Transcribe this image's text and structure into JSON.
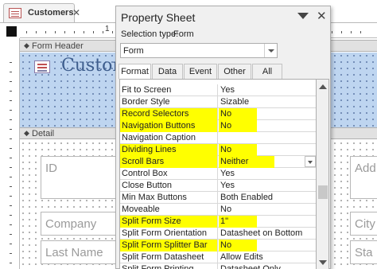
{
  "document_tab": {
    "label": "Customers"
  },
  "ruler": {
    "mark_1": "1"
  },
  "sections": {
    "form_header": "Form Header",
    "detail": "Detail"
  },
  "header": {
    "title_fragment": "Custon"
  },
  "detail": {
    "fields": [
      {
        "label": "ID"
      },
      {
        "label": "Company"
      },
      {
        "label": "Last Name"
      },
      {
        "label": "Add"
      },
      {
        "label": "City"
      },
      {
        "label": "Sta"
      }
    ]
  },
  "property_sheet": {
    "title": "Property Sheet",
    "selection_type_label": "Selection type:",
    "selection_type_value": "Form",
    "object_combo_value": "Form",
    "tabs": [
      "Format",
      "Data",
      "Event",
      "Other",
      "All"
    ],
    "active_tab": "Format",
    "highlight_color": "#ffff00",
    "properties": [
      {
        "name": "Fit to Screen",
        "value": "Yes",
        "highlight": false
      },
      {
        "name": "Border Style",
        "value": "Sizable",
        "highlight": false
      },
      {
        "name": "Record Selectors",
        "value": "No",
        "highlight": true
      },
      {
        "name": "Navigation Buttons",
        "value": "No",
        "highlight": true
      },
      {
        "name": "Navigation Caption",
        "value": "",
        "highlight": false
      },
      {
        "name": "Dividing Lines",
        "value": "No",
        "highlight": true
      },
      {
        "name": "Scroll Bars",
        "value": "Neither",
        "highlight": true,
        "has_dropdown": true
      },
      {
        "name": "Control Box",
        "value": "Yes",
        "highlight": false
      },
      {
        "name": "Close Button",
        "value": "Yes",
        "highlight": false
      },
      {
        "name": "Min Max Buttons",
        "value": "Both Enabled",
        "highlight": false
      },
      {
        "name": "Moveable",
        "value": "No",
        "highlight": false
      },
      {
        "name": "Split Form Size",
        "value": "1\"",
        "highlight": true
      },
      {
        "name": "Split Form Orientation",
        "value": "Datasheet on Bottom",
        "highlight": false
      },
      {
        "name": "Split Form Splitter Bar",
        "value": "No",
        "highlight": true
      },
      {
        "name": "Split Form Datasheet",
        "value": "Allow Edits",
        "highlight": false
      },
      {
        "name": "Split Form Printing",
        "value": "Datasheet Only",
        "highlight": false
      }
    ]
  }
}
